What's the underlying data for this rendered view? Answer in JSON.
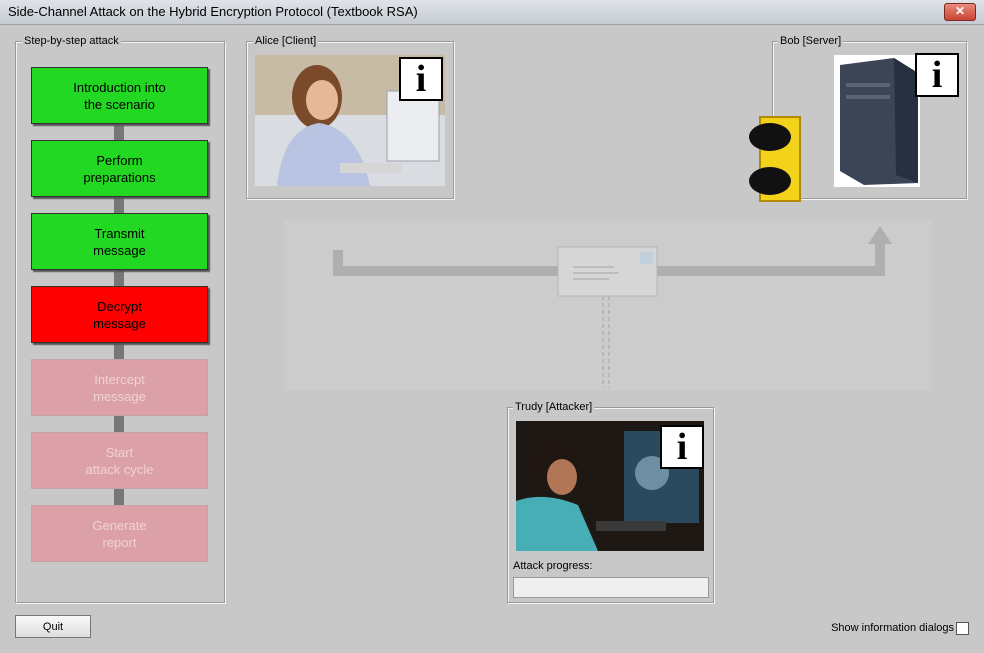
{
  "window": {
    "title": "Side-Channel Attack on the Hybrid Encryption Protocol (Textbook RSA)",
    "close_label": "✕"
  },
  "steps": {
    "legend": "Step-by-step attack",
    "items": [
      {
        "label": "Introduction into\nthe scenario",
        "state": "done"
      },
      {
        "label": "Perform\npreparations",
        "state": "done"
      },
      {
        "label": "Transmit\nmessage",
        "state": "done"
      },
      {
        "label": "Decrypt\nmessage",
        "state": "active"
      },
      {
        "label": "Intercept\nmessage",
        "state": "disabled"
      },
      {
        "label": "Start\nattack cycle",
        "state": "disabled"
      },
      {
        "label": "Generate\nreport",
        "state": "disabled"
      }
    ]
  },
  "alice": {
    "legend": "Alice [Client]"
  },
  "bob": {
    "legend": "Bob [Server]"
  },
  "trudy": {
    "legend": "Trudy [Attacker]",
    "progress_label": "Attack progress:",
    "progress": 0
  },
  "info_glyph": "i",
  "footer": {
    "quit_label": "Quit",
    "show_info_label": "Show information dialogs",
    "show_info_checked": false
  },
  "colors": {
    "green": "#22d822",
    "red": "#ff0000",
    "disabled": "#dca1a8",
    "traffic_light": "#f2d21a"
  }
}
